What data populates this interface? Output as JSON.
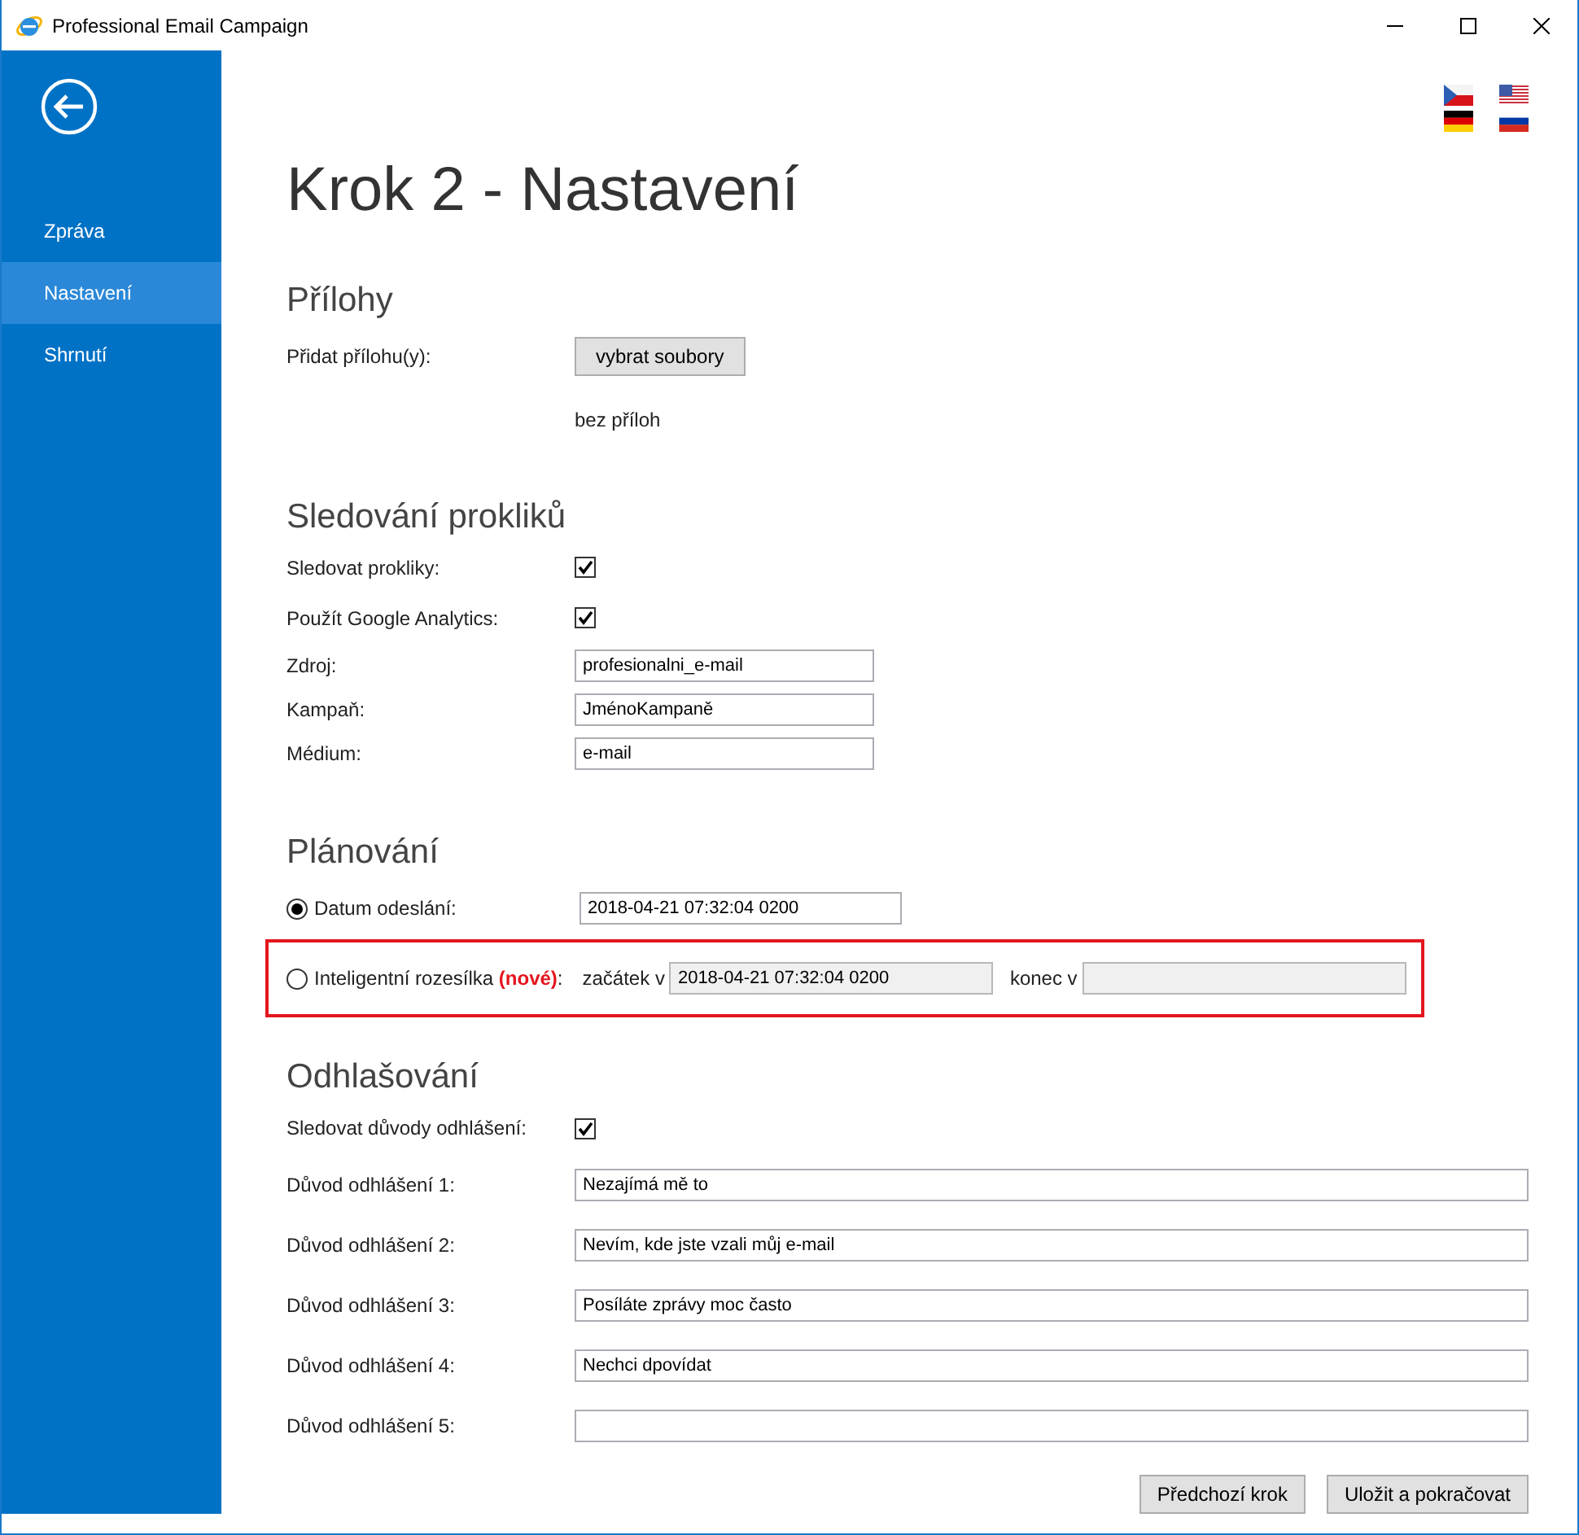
{
  "window": {
    "title": "Professional Email Campaign"
  },
  "sidebar": {
    "items": [
      {
        "label": "Zpráva",
        "selected": false
      },
      {
        "label": "Nastavení",
        "selected": true
      },
      {
        "label": "Shrnutí",
        "selected": false
      }
    ]
  },
  "page_title": "Krok 2 - Nastavení",
  "sections": [
    {
      "heading": "Přílohy",
      "rows": [
        {
          "kind": "button",
          "label": "Přidat přílohu(y):",
          "button": "vybrat soubory"
        },
        {
          "kind": "note",
          "text": "bez příloh"
        }
      ]
    },
    {
      "heading": "Sledování prokliků",
      "rows": [
        {
          "kind": "checkbox",
          "label": "Sledovat prokliky:",
          "checked": true
        },
        {
          "kind": "checkbox",
          "label": "Použít Google Analytics:",
          "checked": true
        },
        {
          "kind": "input",
          "label": "Zdroj:",
          "value": "profesionalni_e-mail"
        },
        {
          "kind": "input",
          "label": "Kampaň:",
          "value": "JménoKampaně"
        },
        {
          "kind": "input",
          "label": "Médium:",
          "value": "e-mail"
        }
      ]
    },
    {
      "heading": "Plánování",
      "rows": [
        {
          "kind": "radio",
          "label": "Datum odeslání:",
          "selected": true,
          "value": "2018-04-21 07:32:04 0200"
        },
        {
          "kind": "smart",
          "label": "Inteligentní rozesílka",
          "badge": "(nové)",
          "colon": ":",
          "selected": false,
          "start_label": "začátek v",
          "start_value": "2018-04-21 07:32:04 0200",
          "end_label": "konec v"
        }
      ]
    },
    {
      "heading": "Odhlašování",
      "rows": [
        {
          "kind": "checkbox",
          "label": "Sledovat důvody odhlášení:",
          "checked": true
        },
        {
          "kind": "wide",
          "label": "Důvod odhlášení 1:",
          "value": "Nezajímá mě to"
        },
        {
          "kind": "wide",
          "label": "Důvod odhlášení 2:",
          "value": "Nevím, kde jste vzali můj e-mail"
        },
        {
          "kind": "wide",
          "label": "Důvod odhlášení 3:",
          "value": "Posíláte zprávy moc často"
        },
        {
          "kind": "wide",
          "label": "Důvod odhlášení 4:",
          "value": "Nechci dpovídat"
        },
        {
          "kind": "wide",
          "label": "Důvod odhlášení 5:"
        }
      ]
    }
  ],
  "footer_buttons": [
    "Předchozí krok",
    "Uložit a pokračovat"
  ]
}
